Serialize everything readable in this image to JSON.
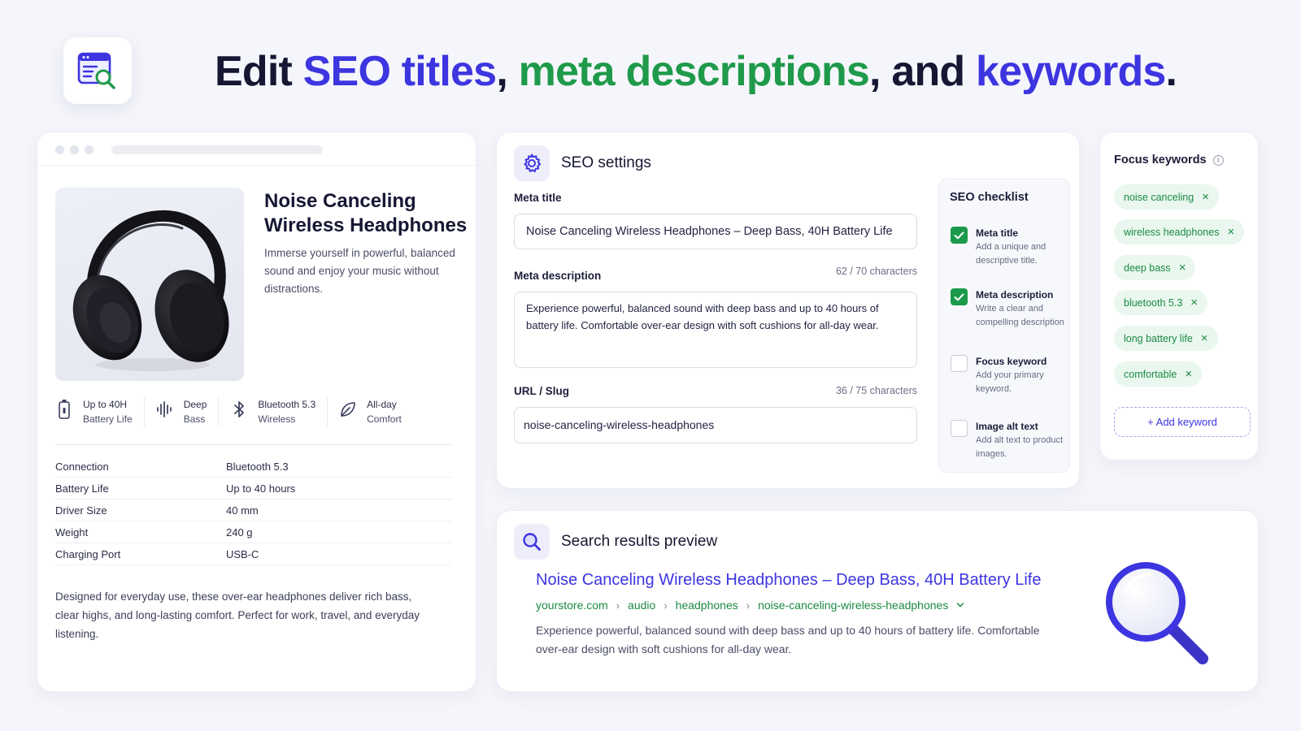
{
  "headline": {
    "part1": "Edit ",
    "part2": "SEO titles",
    "part3": ", ",
    "part4": "meta descriptions",
    "part5": ", and ",
    "part6": "keywords",
    "part7": "."
  },
  "product": {
    "title": "Noise Canceling Wireless Headphones",
    "description": "Immerse yourself in powerful, balanced sound and enjoy your music without distractions.",
    "features": [
      {
        "icon": "battery-icon",
        "line1": "Up to 40H",
        "line2": "Battery Life"
      },
      {
        "icon": "soundwave-icon",
        "line1": "Deep",
        "line2": "Bass"
      },
      {
        "icon": "bluetooth-icon",
        "line1": "Bluetooth 5.3",
        "line2": "Wireless"
      },
      {
        "icon": "leaf-icon",
        "line1": "All-day",
        "line2": "Comfort"
      }
    ],
    "specs": [
      {
        "key": "Connection",
        "value": "Bluetooth 5.3"
      },
      {
        "key": "Battery Life",
        "value": "Up to 40 hours"
      },
      {
        "key": "Driver Size",
        "value": "40 mm"
      },
      {
        "key": "Weight",
        "value": "240 g"
      },
      {
        "key": "Charging Port",
        "value": "USB-C"
      }
    ],
    "footer": "Designed for everyday use, these over-ear headphones deliver rich bass, clear highs, and long-lasting comfort. Perfect for work, travel, and everyday listening."
  },
  "seo": {
    "heading": "SEO settings",
    "meta_title_label": "Meta title",
    "meta_title_value": "Noise Canceling Wireless Headphones – Deep Bass, 40H Battery Life",
    "meta_desc_label": "Meta description",
    "meta_desc_count": "62 / 70 characters",
    "meta_desc_value": "Experience powerful, balanced sound with deep bass and up to 40 hours of battery life. Comfortable over-ear design with soft cushions for all-day wear.",
    "slug_label": "URL / Slug",
    "slug_count": "36 / 75 characters",
    "slug_value": "noise-canceling-wireless-headphones",
    "checklist": {
      "heading": "SEO checklist",
      "items": [
        {
          "title": "Meta title",
          "desc": "Add a unique and descriptive title.",
          "checked": true
        },
        {
          "title": "Meta description",
          "desc": "Write a clear and compelling description",
          "checked": true
        },
        {
          "title": "Focus keyword",
          "desc": "Add your primary keyword.",
          "checked": false
        },
        {
          "title": "Image alt text",
          "desc": "Add alt text to product images.",
          "checked": false
        }
      ]
    }
  },
  "keywords": {
    "heading": "Focus keywords",
    "items": [
      "noise canceling",
      "wireless headphones",
      "deep bass",
      "bluetooth 5.3",
      "long battery life",
      "comfortable"
    ],
    "add_label": "+ Add keyword"
  },
  "preview": {
    "heading": "Search results preview",
    "title": "Noise Canceling Wireless Headphones – Deep Bass, 40H Battery Life",
    "crumbs": [
      "yourstore.com",
      "audio",
      "headphones",
      "noise-canceling-wireless-headphones"
    ],
    "crumb_sep": "›",
    "description": "Experience powerful, balanced sound with deep bass and up to 40 hours of battery life. Comfortable over-ear design with soft cushions for all-day wear."
  },
  "colors": {
    "brand_blue": "#3d35e0",
    "brand_green": "#1f9a4a",
    "chip_bg": "#e9f7ee"
  }
}
